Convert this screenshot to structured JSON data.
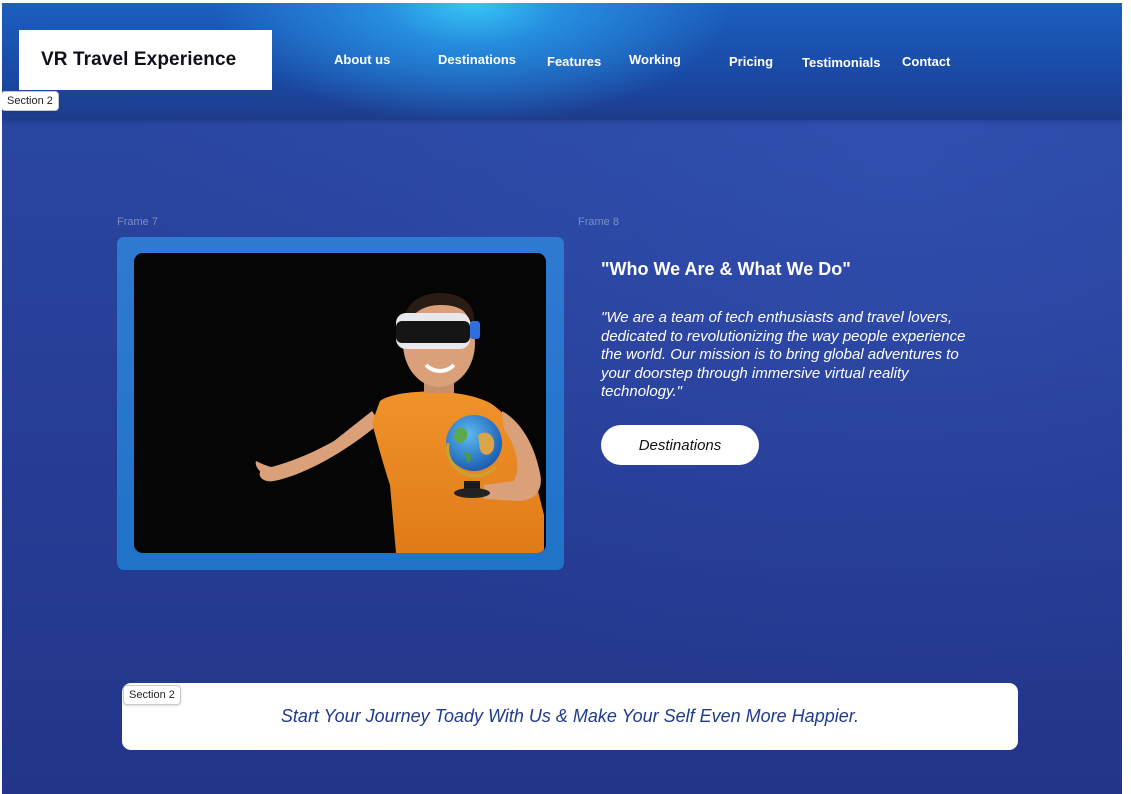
{
  "brand": {
    "title": "VR Travel Experience"
  },
  "nav": {
    "items": [
      "About us",
      "Destinations",
      "Features",
      "Working",
      "Pricing",
      "Testimonials",
      "Contact"
    ]
  },
  "labels": {
    "section_tag_top": "Section 2",
    "section_tag_bottom": "Section 2",
    "frame_left": "Frame 7",
    "frame_right": "Frame 8"
  },
  "about": {
    "heading": "\"Who We Are & What We Do\"",
    "body": "\"We are a team of tech enthusiasts and travel lovers, dedicated to revolutionizing the way people experience the world. Our mission is to bring global adventures to your doorstep through immersive virtual reality technology.\"",
    "button_label": "Destinations"
  },
  "banner": {
    "text": "Start Your Journey Toady With Us & Make Your Self Even More Happier."
  },
  "colors": {
    "background": "#283f98",
    "header_glow": "#36c6f4",
    "frame_blue": "#1f73c8",
    "banner_text": "#1f3a8f"
  }
}
